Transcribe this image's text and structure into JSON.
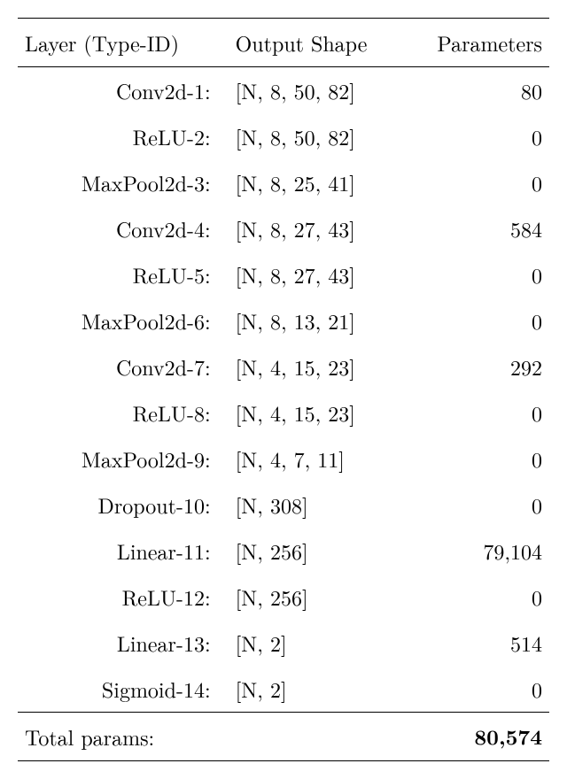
{
  "chart_data": {
    "type": "table",
    "columns": [
      "Layer (Type-ID)",
      "Output Shape",
      "Parameters"
    ],
    "rows": [
      {
        "layer": "Conv2d-1:",
        "shape": "[N, 8, 50, 82]",
        "params": "80"
      },
      {
        "layer": "ReLU-2:",
        "shape": "[N, 8, 50, 82]",
        "params": "0"
      },
      {
        "layer": "MaxPool2d-3:",
        "shape": "[N, 8, 25, 41]",
        "params": "0"
      },
      {
        "layer": "Conv2d-4:",
        "shape": "[N, 8, 27, 43]",
        "params": "584"
      },
      {
        "layer": "ReLU-5:",
        "shape": "[N, 8, 27, 43]",
        "params": "0"
      },
      {
        "layer": "MaxPool2d-6:",
        "shape": "[N, 8, 13, 21]",
        "params": "0"
      },
      {
        "layer": "Conv2d-7:",
        "shape": "[N, 4, 15, 23]",
        "params": "292"
      },
      {
        "layer": "ReLU-8:",
        "shape": "[N, 4, 15, 23]",
        "params": "0"
      },
      {
        "layer": "MaxPool2d-9:",
        "shape": "[N, 4, 7, 11]",
        "params": "0"
      },
      {
        "layer": "Dropout-10:",
        "shape": "[N, 308]",
        "params": "0"
      },
      {
        "layer": "Linear-11:",
        "shape": "[N, 256]",
        "params": "79,104"
      },
      {
        "layer": "ReLU-12:",
        "shape": "[N, 256]",
        "params": "0"
      },
      {
        "layer": "Linear-13:",
        "shape": "[N, 2]",
        "params": "514"
      },
      {
        "layer": "Sigmoid-14:",
        "shape": "[N, 2]",
        "params": "0"
      }
    ],
    "total_label": "Total params:",
    "total_value": "80,574"
  }
}
